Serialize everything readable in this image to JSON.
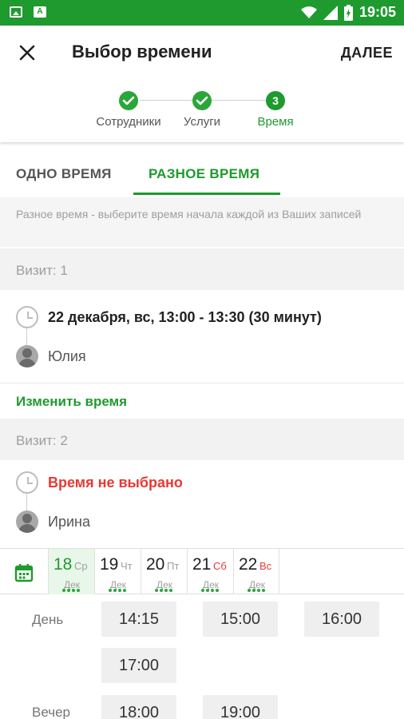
{
  "status_bar": {
    "time": "19:05",
    "icons": [
      "image-icon",
      "a-icon",
      "wifi-icon",
      "signal-icon",
      "battery-charging-icon"
    ]
  },
  "app_bar": {
    "title": "Выбор времени",
    "next_label": "ДАЛЕЕ"
  },
  "stepper": {
    "steps": [
      {
        "label": "Сотрудники",
        "state": "done"
      },
      {
        "label": "Услуги",
        "state": "done"
      },
      {
        "label": "Время",
        "state": "current",
        "number": "3"
      }
    ]
  },
  "tabs": [
    {
      "label": "ОДНО ВРЕМЯ",
      "active": false
    },
    {
      "label": "РАЗНОЕ ВРЕМЯ",
      "active": true
    }
  ],
  "hint": "Разное время - выберите время начала каждой из Ваших записей",
  "visits": [
    {
      "header": "Визит: 1",
      "time": "22 декабря, вс, 13:00 - 13:30 (30 минут)",
      "staff": "Юлия"
    },
    {
      "header": "Визит: 2",
      "time": "Время не выбрано",
      "staff": "Ирина"
    }
  ],
  "change_time_label": "Изменить время",
  "dates": [
    {
      "num": "18",
      "dow": "Ср",
      "mon": "Дек",
      "weekend": false,
      "selected": true
    },
    {
      "num": "19",
      "dow": "Чт",
      "mon": "Дек",
      "weekend": false,
      "selected": false
    },
    {
      "num": "20",
      "dow": "Пт",
      "mon": "Дек",
      "weekend": false,
      "selected": false
    },
    {
      "num": "21",
      "dow": "Сб",
      "mon": "Дек",
      "weekend": true,
      "selected": false
    },
    {
      "num": "22",
      "dow": "Вс",
      "mon": "Дек",
      "weekend": true,
      "selected": false
    }
  ],
  "time_slots": {
    "day_label": "День",
    "day": [
      "14:15",
      "15:00",
      "16:00",
      "17:00"
    ],
    "evening_label": "Вечер",
    "evening": [
      "18:00",
      "19:00"
    ]
  },
  "colors": {
    "primary": "#1e9a2e",
    "error": "#e53935"
  }
}
